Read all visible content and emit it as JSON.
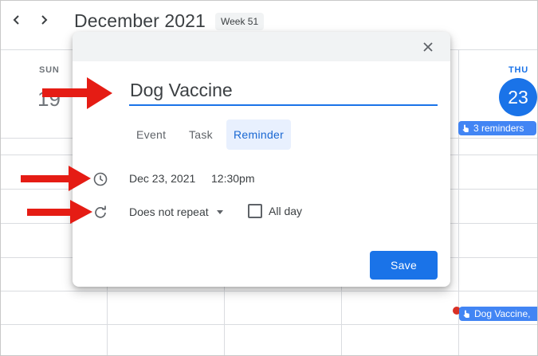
{
  "header": {
    "prev_icon": "chevron-left-icon",
    "next_icon": "chevron-right-icon",
    "month_title": "December 2021",
    "week_badge": "Week 51"
  },
  "days": {
    "sunday": {
      "name": "SUN",
      "number": "19"
    },
    "thursday": {
      "name": "THU",
      "number": "23"
    }
  },
  "events": {
    "reminders_chip": "3 reminders",
    "event_chip": "Dog Vaccine,"
  },
  "dialog": {
    "close_icon": "close-icon",
    "title_value": "Dog Vaccine",
    "tabs": [
      "Event",
      "Task",
      "Reminder"
    ],
    "active_tab": "Reminder",
    "date": "Dec 23, 2021",
    "time": "12:30pm",
    "repeat": "Does not repeat",
    "all_day_label": "All day",
    "all_day_checked": false,
    "save_label": "Save"
  },
  "colors": {
    "accent": "#1a73e8",
    "chip": "#4285f4",
    "annotation_arrow": "#e51c14",
    "dot": "#d93025"
  }
}
